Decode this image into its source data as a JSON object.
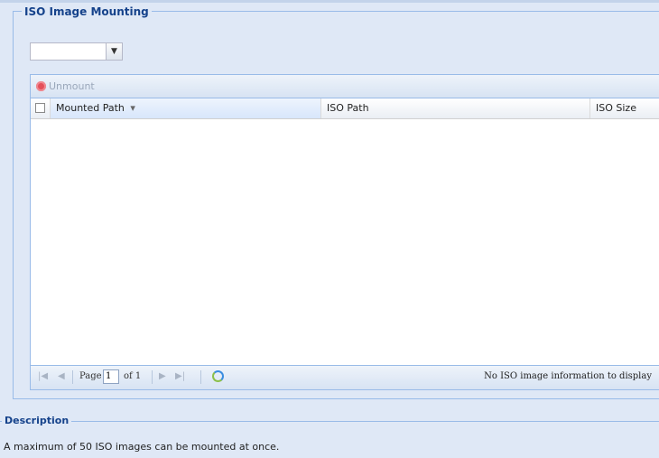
{
  "iso_panel": {
    "legend": "ISO Image Mounting",
    "combo_value": ""
  },
  "toolbar": {
    "unmount_label": "Unmount"
  },
  "grid": {
    "columns": [
      "Mounted Path",
      "ISO Path",
      "ISO Size"
    ],
    "sort_indicator": "▾",
    "rows": []
  },
  "paging": {
    "page_label": "Page",
    "current_page": "1",
    "of_total": "of 1",
    "empty_message": "No ISO image information to display"
  },
  "description": {
    "legend": "Description",
    "text": "A maximum of 50 ISO images can be mounted at once."
  },
  "icons": {
    "unmount": "unmount-icon",
    "refresh": "refresh-icon"
  }
}
